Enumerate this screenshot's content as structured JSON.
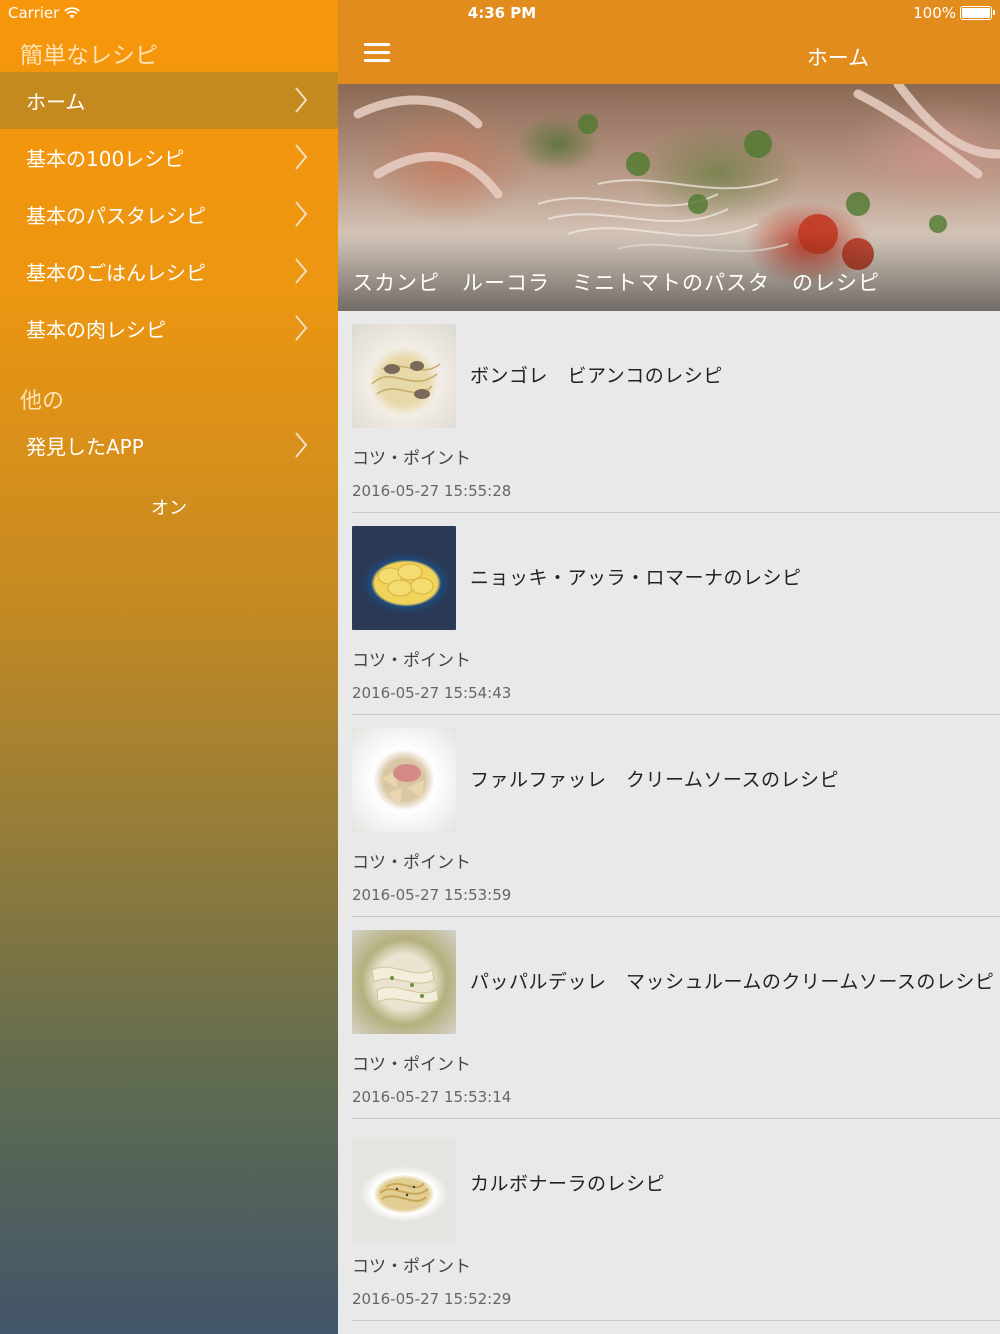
{
  "status": {
    "carrier": "Carrier",
    "time": "4:36 PM",
    "battery": "100%"
  },
  "sidebar": {
    "app_title": "簡単なレシピ",
    "items": [
      {
        "label": "ホーム",
        "active": true
      },
      {
        "label": "基本の100レシピ"
      },
      {
        "label": "基本のパスタレシピ"
      },
      {
        "label": "基本のごはんレシピ"
      },
      {
        "label": "基本の肉レシピ"
      }
    ],
    "section_title": "他の",
    "other_items": [
      {
        "label": "発見したAPP"
      }
    ],
    "footer_text": "オン"
  },
  "navbar": {
    "title": "ホーム"
  },
  "hero": {
    "caption": "スカンピ　ルーコラ　ミニトマトのパスタ　のレシピ"
  },
  "recipes": [
    {
      "title": "ボンゴレ　ビアンコのレシピ",
      "point": "コツ・ポイント",
      "date": "2016-05-27 15:55:28"
    },
    {
      "title": "ニョッキ・アッラ・ロマーナのレシピ",
      "point": "コツ・ポイント",
      "date": "2016-05-27 15:54:43"
    },
    {
      "title": "ファルファッレ　クリームソースのレシピ",
      "point": "コツ・ポイント",
      "date": "2016-05-27 15:53:59"
    },
    {
      "title": "パッパルデッレ　マッシュルームのクリームソースのレシピ",
      "point": "コツ・ポイント",
      "date": "2016-05-27 15:53:14"
    },
    {
      "title": "カルボナーラのレシピ",
      "point": "コツ・ポイント",
      "date": "2016-05-27 15:52:29"
    }
  ],
  "icons": {
    "menu": "hamburger-menu-icon",
    "chevron": "chevron-right-icon",
    "wifi": "wifi-icon",
    "battery": "battery-icon"
  },
  "colors": {
    "navbar": "#e28c1d",
    "sidebar_top": "#f7960a",
    "sidebar_bottom": "#42556a",
    "active_item": "#c58a1f"
  }
}
